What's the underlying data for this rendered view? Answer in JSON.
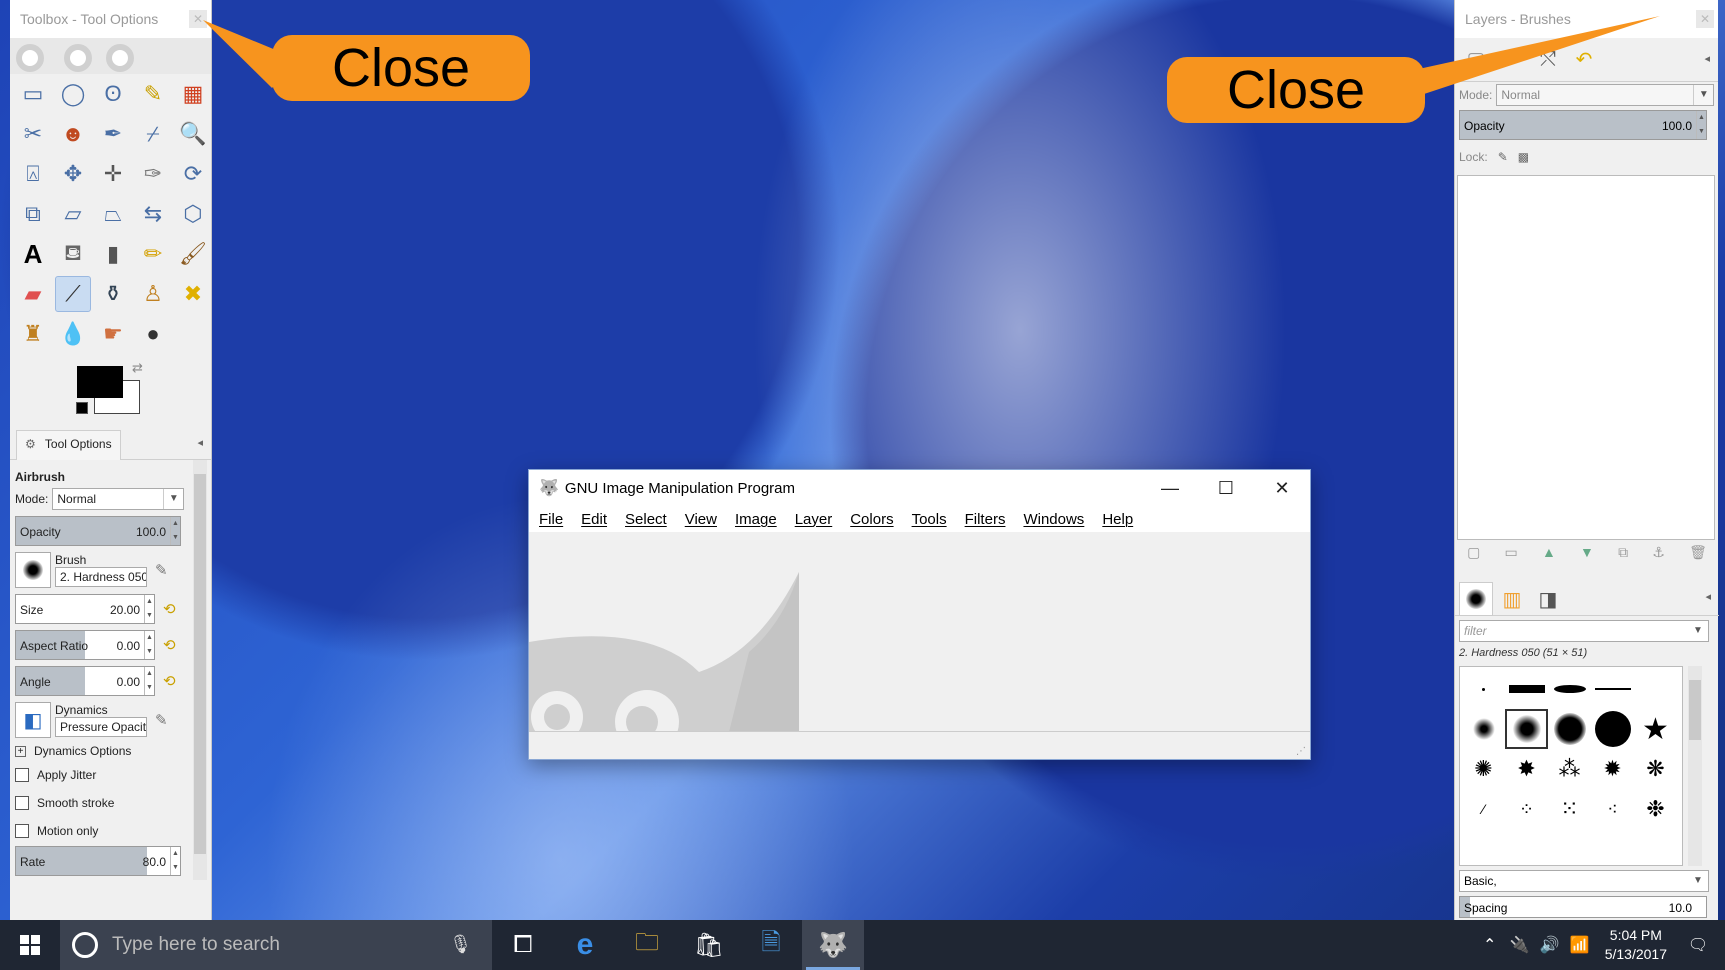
{
  "toolbox": {
    "title": "Toolbox - Tool Options",
    "tool_options_tab": "Tool Options",
    "tool_name": "Airbrush",
    "mode_label": "Mode:",
    "mode_value": "Normal",
    "opacity_label": "Opacity",
    "opacity_value": "100.0",
    "brush_label": "Brush",
    "brush_value": "2. Hardness 050",
    "size_label": "Size",
    "size_value": "20.00",
    "aspect_label": "Aspect Ratio",
    "aspect_value": "0.00",
    "angle_label": "Angle",
    "angle_value": "0.00",
    "dynamics_label": "Dynamics",
    "dynamics_value": "Pressure Opacit",
    "dynamics_options": "Dynamics Options",
    "apply_jitter": "Apply Jitter",
    "smooth_stroke": "Smooth stroke",
    "motion_only": "Motion only",
    "rate_label": "Rate",
    "rate_value": "80.0",
    "opacity_fraction": 1.0,
    "size_fraction": 0.0,
    "aspect_fraction": 0.5,
    "angle_fraction": 0.5,
    "rate_fraction": 0.8
  },
  "dock": {
    "title": "Layers - Brushes",
    "mode_label": "Mode:",
    "mode_value": "Normal",
    "opacity_label": "Opacity",
    "opacity_value": "100.0",
    "lock_label": "Lock:",
    "filter_placeholder": "filter",
    "brush_name": "2. Hardness 050 (51 × 51)",
    "brush_category": "Basic,",
    "spacing_label": "Spacing",
    "spacing_value": "10.0"
  },
  "callouts": {
    "left": "Close",
    "right": "Close"
  },
  "gimp_window": {
    "title": "GNU Image Manipulation Program",
    "menus": [
      "File",
      "Edit",
      "Select",
      "View",
      "Image",
      "Layer",
      "Colors",
      "Tools",
      "Filters",
      "Windows",
      "Help"
    ]
  },
  "taskbar": {
    "search_placeholder": "Type here to search",
    "time": "5:04 PM",
    "date": "5/13/2017"
  },
  "colors": {
    "callout": "#f7941e",
    "fg_color": "#000000",
    "bg_color": "#ffffff",
    "taskbar": "#1f2633"
  }
}
